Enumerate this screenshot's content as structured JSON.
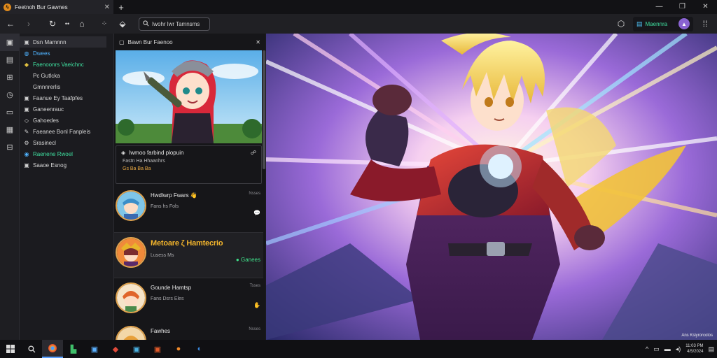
{
  "browser": {
    "tab_title": "Feetnoh Bur Gawnes",
    "tab_icon": "flame-logo-icon",
    "new_tab": "+",
    "window_controls": [
      "—",
      "❐",
      "✕"
    ]
  },
  "toolbar": {
    "address_text": "Iwohr lwr Tamnsms",
    "profile_name": "Maennra",
    "icons": [
      "back-arrow-icon",
      "forward-arrow-icon",
      "reload-icon",
      "home-icon",
      "extensions-icon",
      "menu-icon"
    ]
  },
  "sidebar": {
    "items": [
      {
        "icon": "▣",
        "label": "Dsn Mamnnn"
      },
      {
        "icon": "◍",
        "label": "Dwees"
      },
      {
        "icon": "◆",
        "label": "Faenoonrs Vaeichnc"
      },
      {
        "icon": "",
        "label": "Pc Gutlcka"
      },
      {
        "icon": "",
        "label": "Gmnnrerlis"
      },
      {
        "icon": "▣",
        "label": "Faanue Ey Taafpfes"
      },
      {
        "icon": "▣",
        "label": "Ganeenrauc"
      },
      {
        "icon": "◇",
        "label": "Gahoedes"
      },
      {
        "icon": "✎",
        "label": "Faeanee Bonl Fanpleis"
      },
      {
        "icon": "⚙",
        "label": "Srasinecl"
      },
      {
        "icon": "◉",
        "label": "Raenene Rwoel"
      },
      {
        "icon": "▣",
        "label": "Saaoe Esnog"
      }
    ]
  },
  "panel": {
    "title": "Bawn Bur Faenoo",
    "info_title": "Iwmoo farbind plopuin",
    "info_line2": "Fastn Ha Hhaanhrs",
    "info_line3": "Gs Ba Ba Ba",
    "items": [
      {
        "name": "Hwdlwrp Fwars 👋",
        "sub": "Fans hs Fols",
        "time": "Nsses",
        "action": "💬",
        "highlight": false,
        "big": false
      },
      {
        "name": "Metoare ζ Hamtecrio",
        "sub": "Lusess Ms",
        "time": "",
        "action": "● Ganees",
        "highlight": true,
        "big": true
      },
      {
        "name": "Gounde Hamtsp",
        "sub": "Fans Dsrs Eles",
        "time": "Tsses",
        "action": "✋",
        "highlight": false,
        "big": false
      },
      {
        "name": "Fawhes",
        "sub": "",
        "time": "Nsses",
        "action": "",
        "highlight": false,
        "big": false
      }
    ]
  },
  "artwork": {
    "credit": "Ans Ksiyrorcolos"
  },
  "taskbar": {
    "apps": [
      "windows-start-icon",
      "search-icon",
      "browser-icon",
      "files-icon",
      "store-icon",
      "game-icon",
      "photos-icon",
      "office-icon",
      "firefox-icon",
      "edge-icon"
    ],
    "clock_time": "11:03 PM",
    "clock_date": "4/5/2024"
  },
  "colors": {
    "accent_green": "#3fe0a0",
    "highlight_gold": "#f2b42c",
    "window_bg": "#1b1b1f"
  }
}
